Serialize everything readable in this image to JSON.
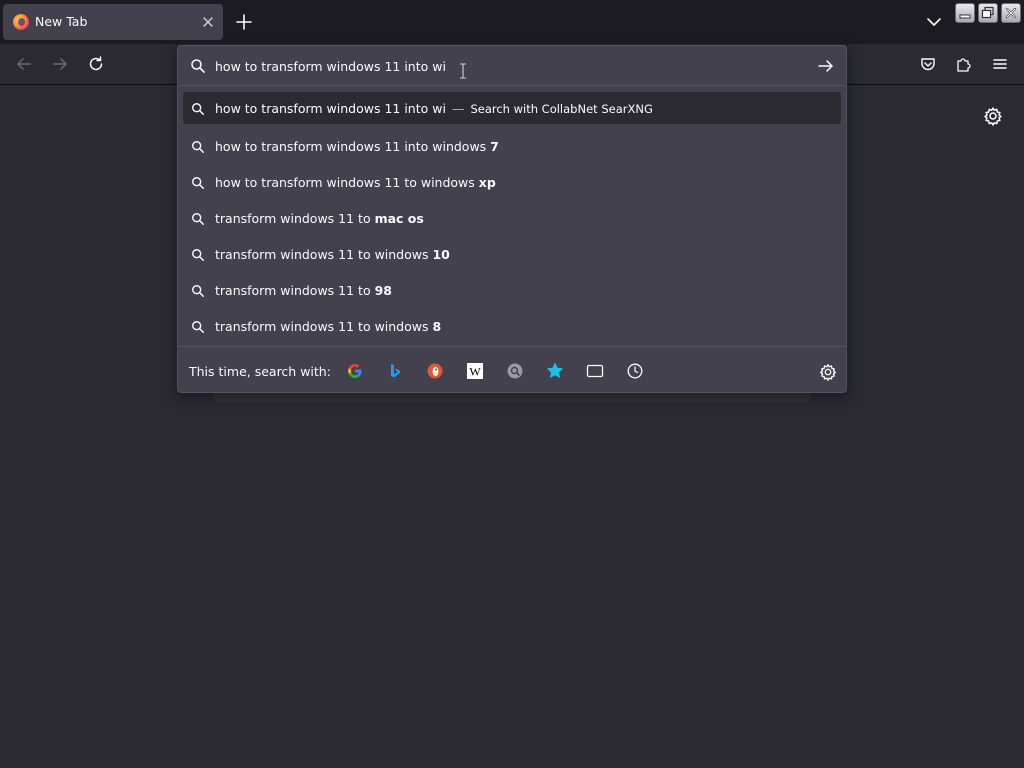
{
  "tab": {
    "title": "New Tab",
    "close_icon": "close-icon",
    "favicon": "firefox-logo"
  },
  "toolbar": {
    "back_icon": "arrow-left-icon",
    "forward_icon": "arrow-right-icon",
    "reload_icon": "reload-icon",
    "pocket_icon": "pocket-icon",
    "extensions_icon": "puzzle-icon",
    "menu_icon": "hamburger-menu-icon"
  },
  "urlbar": {
    "value": "how to transform windows 11 into wi",
    "go_icon": "arrow-right-icon"
  },
  "results": [
    {
      "typed": "how to transform windows 11 into wi",
      "completion": "",
      "dash": "—",
      "action": "Search with CollabNet SearXNG",
      "selected": true
    },
    {
      "typed": "how to transform windows 11 into windows ",
      "completion": "7"
    },
    {
      "typed": "how to transform windows 11 to windows ",
      "completion": "xp"
    },
    {
      "typed": "transform windows 11 to ",
      "completion": "mac os"
    },
    {
      "typed": "transform windows 11 to windows ",
      "completion": "10"
    },
    {
      "typed": "transform windows 11 to ",
      "completion": "98"
    },
    {
      "typed": "transform windows 11 to windows ",
      "completion": "8"
    }
  ],
  "oneoff": {
    "label": "This time, search with:",
    "engines": [
      "google-icon",
      "bing-icon",
      "duckduckgo-icon",
      "wikipedia-icon",
      "searxng-icon",
      "bookmarks-star-icon",
      "tabs-icon",
      "history-clock-icon"
    ]
  },
  "colors": {
    "tabstrip": "#1c1b22",
    "toolbar": "#2b2a33",
    "popup": "#42414d",
    "selected_row": "#2b2a33",
    "text": "#fbfbfe"
  }
}
